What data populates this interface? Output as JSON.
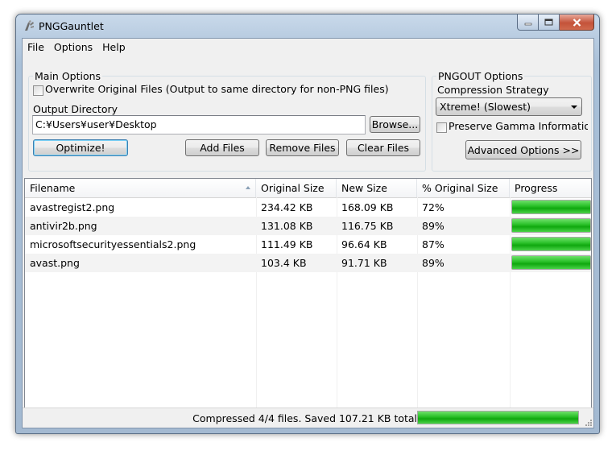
{
  "window": {
    "title": "PNGGauntlet"
  },
  "menu": [
    "File",
    "Options",
    "Help"
  ],
  "main_options": {
    "group_label": "Main Options",
    "overwrite_label": "Overwrite Original Files (Output to same directory for non-PNG files)",
    "overwrite_checked": false,
    "output_dir_label": "Output Directory",
    "output_dir_value": "C:¥Users¥user¥Desktop",
    "browse_label": "Browse...",
    "optimize_label": "Optimize!",
    "add_files_label": "Add Files",
    "remove_files_label": "Remove Files",
    "clear_files_label": "Clear Files"
  },
  "pngout_options": {
    "group_label": "PNGOUT Options",
    "strategy_label": "Compression Strategy",
    "strategy_value": "Xtreme! (Slowest)",
    "preserve_gamma_label": "Preserve Gamma Information",
    "preserve_gamma_checked": false,
    "advanced_label": "Advanced Options >>"
  },
  "table": {
    "columns": [
      "Filename",
      "Original Size",
      "New Size",
      "% Original Size",
      "Progress"
    ],
    "sort_column": "Filename",
    "rows": [
      {
        "filename": "avastregist2.png",
        "original": "234.42 KB",
        "new": "168.09 KB",
        "percent": "72%",
        "progress": 1.0
      },
      {
        "filename": "antivir2b.png",
        "original": "131.08 KB",
        "new": "116.75 KB",
        "percent": "89%",
        "progress": 1.0
      },
      {
        "filename": "microsoftsecurityessentials2.png",
        "original": "111.49 KB",
        "new": "96.64 KB",
        "percent": "87%",
        "progress": 1.0
      },
      {
        "filename": "avast.png",
        "original": "103.4 KB",
        "new": "91.71 KB",
        "percent": "89%",
        "progress": 1.0
      }
    ]
  },
  "status": {
    "text": "Compressed 4/4 files. Saved 107.21 KB total.",
    "progress": 1.0
  },
  "colors": {
    "progress_green": "#2ec32d",
    "close_red": "#c4533a"
  }
}
